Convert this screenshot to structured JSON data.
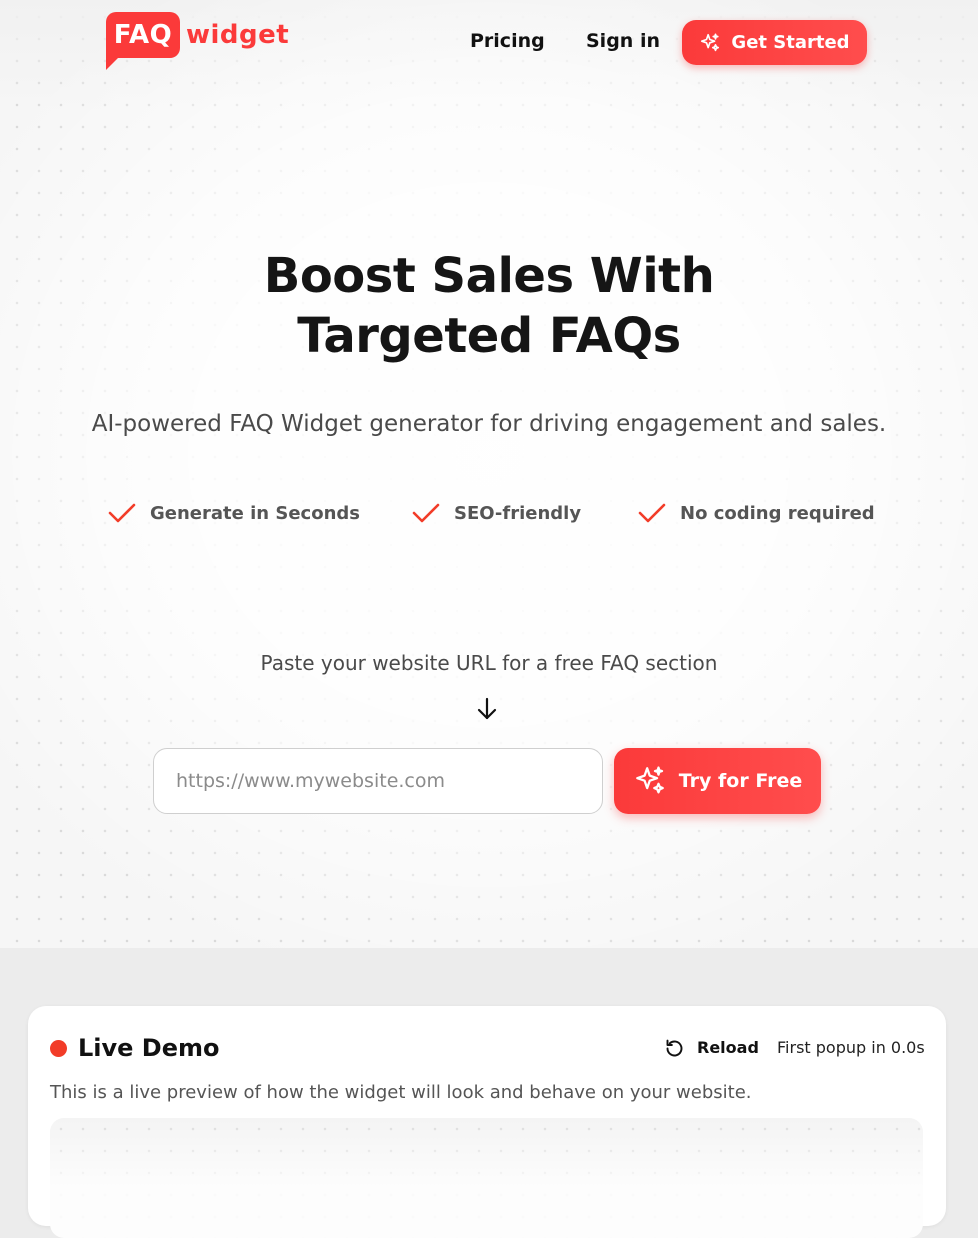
{
  "brand": {
    "logo_badge": "FAQ",
    "logo_word": "widget",
    "accent": "#fb3a3a"
  },
  "nav": {
    "pricing": "Pricing",
    "sign_in": "Sign in",
    "get_started": "Get Started"
  },
  "hero": {
    "headline_line1": "Boost Sales With",
    "headline_line2": "Targeted FAQs",
    "subheadline": "AI-powered FAQ Widget generator for driving engagement and sales.",
    "features": [
      "Generate in Seconds",
      "SEO-friendly",
      "No coding required"
    ],
    "paste_label": "Paste your website URL for a free FAQ section",
    "url_placeholder": "https://www.mywebsite.com",
    "try_button": "Try for Free"
  },
  "demo": {
    "title": "Live Demo",
    "reload": "Reload",
    "popup_timer": "First popup in 0.0s",
    "description": "This is a live preview of how the widget will look and behave on your website.",
    "status_color": "#f23c28"
  },
  "icons": {
    "sparkle": "sparkle-icon",
    "check": "check-icon",
    "arrow": "arrow-down-icon",
    "reload": "reload-icon"
  }
}
